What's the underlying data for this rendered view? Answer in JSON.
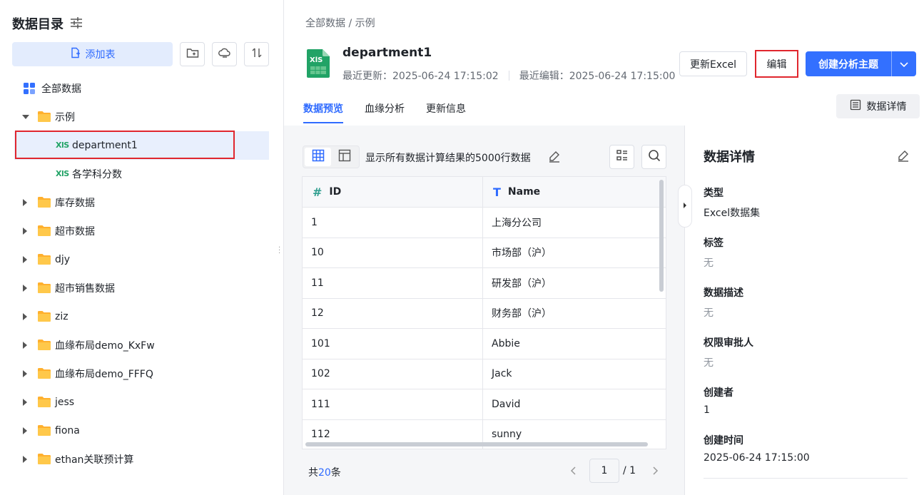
{
  "sidebar": {
    "title": "数据目录",
    "add_table_label": "添加表",
    "tree": {
      "all_data": "全部数据",
      "folder_example": "示例",
      "file_selected": "department1",
      "file_other": "各学科分数",
      "file_type": "XlS",
      "folders": [
        "库存数据",
        "超市数据",
        "djy",
        "超市销售数据",
        "ziz",
        "血缘布局demo_KxFw",
        "血缘布局demo_FFFQ",
        "jess",
        "fiona",
        "ethan关联预计算"
      ]
    }
  },
  "breadcrumb": "全部数据  / 示例",
  "dataset": {
    "name": "department1",
    "last_update": "最近更新：2025-06-24 17:15:02",
    "last_edit": "最近编辑：2025-06-24 17:15:00"
  },
  "actions": {
    "update_excel": "更新Excel",
    "edit": "编辑",
    "create_topic": "创建分析主题",
    "details": "数据详情"
  },
  "tabs": [
    "数据预览",
    "血缘分析",
    "更新信息"
  ],
  "preview": {
    "note": "显示所有数据计算结果的5000行数据",
    "columns": [
      "ID",
      "Name"
    ],
    "rows": [
      [
        "1",
        "上海分公司"
      ],
      [
        "10",
        "市场部（沪）"
      ],
      [
        "11",
        "研发部（沪）"
      ],
      [
        "12",
        "财务部（沪）"
      ],
      [
        "101",
        "Abbie"
      ],
      [
        "102",
        "Jack"
      ],
      [
        "111",
        "David"
      ],
      [
        "112",
        "sunny"
      ]
    ],
    "total_prefix": "共",
    "total_count": "20",
    "total_suffix": "条",
    "page": "1",
    "page_of": "/ 1"
  },
  "details_panel": {
    "title": "数据详情",
    "fields": [
      {
        "label": "类型",
        "value": "Excel数据集",
        "muted": false
      },
      {
        "label": "标签",
        "value": "无",
        "muted": true
      },
      {
        "label": "数据描述",
        "value": "无",
        "muted": true
      },
      {
        "label": "权限审批人",
        "value": "无",
        "muted": true
      },
      {
        "label": "创建者",
        "value": "1",
        "muted": false
      },
      {
        "label": "创建时间",
        "value": "2025-06-24 17:15:00",
        "muted": false
      }
    ]
  },
  "colors": {
    "accent": "#3370ff",
    "excel_green": "#21a366",
    "folder": "#ffb02e",
    "highlight_red": "#e0262e"
  }
}
